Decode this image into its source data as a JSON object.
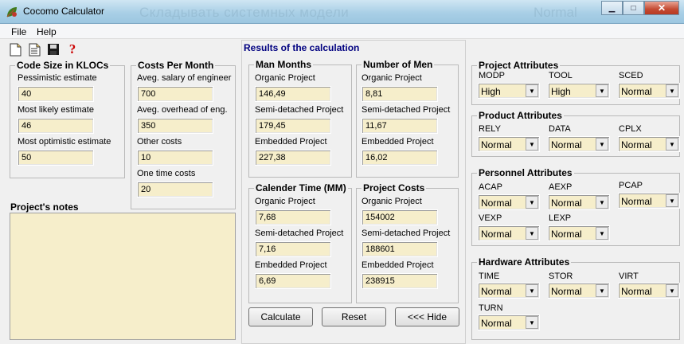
{
  "window": {
    "title": "Cocomo Calculator",
    "background_title": "Складывать системных модели",
    "background_title2": "Normal",
    "minimize_label": "▁",
    "maximize_label": "□",
    "close_label": "✕"
  },
  "menu": {
    "file": "File",
    "help": "Help"
  },
  "toolbar": {
    "help_glyph": "?"
  },
  "code_size": {
    "title": "Code Size in KLOCs",
    "pessimistic_label": "Pessimistic estimate",
    "pessimistic_value": "40",
    "likely_label": "Most likely estimate",
    "likely_value": "46",
    "optimistic_label": "Most optimistic estimate",
    "optimistic_value": "50"
  },
  "costs": {
    "title": "Costs Per Month",
    "salary_label": "Aveg. salary of engineer",
    "salary_value": "700",
    "overhead_label": "Aveg. overhead of eng.",
    "overhead_value": "350",
    "other_label": "Other costs",
    "other_value": "10",
    "onetime_label": "One time costs",
    "onetime_value": "20"
  },
  "notes": {
    "title": "Project's notes",
    "value": ""
  },
  "results": {
    "title": "Results of the calculation",
    "man_months": {
      "title": "Man Months",
      "organic_label": "Organic Project",
      "organic_value": "146,49",
      "semi_label": "Semi-detached Project",
      "semi_value": "179,45",
      "embedded_label": "Embedded Project",
      "embedded_value": "227,38"
    },
    "number_of_men": {
      "title": "Number of Men",
      "organic_label": "Organic Project",
      "organic_value": "8,81",
      "semi_label": "Semi-detached Project",
      "semi_value": "11,67",
      "embedded_label": "Embedded Project",
      "embedded_value": "16,02"
    },
    "calendar_time": {
      "title": "Calender Time (MM)",
      "organic_label": "Organic Project",
      "organic_value": "7,68",
      "semi_label": "Semi-detached Project",
      "semi_value": "7,16",
      "embedded_label": "Embedded Project",
      "embedded_value": "6,69"
    },
    "project_costs": {
      "title": "Project Costs",
      "organic_label": "Organic Project",
      "organic_value": "154002",
      "semi_label": "Semi-detached Project",
      "semi_value": "188601",
      "embedded_label": "Embedded Project",
      "embedded_value": "238915"
    },
    "buttons": {
      "calculate": "Calculate",
      "reset": "Reset",
      "hide": "<<< Hide"
    }
  },
  "project_attributes": {
    "title": "Project Attributes",
    "modp_label": "MODP",
    "modp_value": "High",
    "tool_label": "TOOL",
    "tool_value": "High",
    "sced_label": "SCED",
    "sced_value": "Normal"
  },
  "product_attributes": {
    "title": "Product Attributes",
    "rely_label": "RELY",
    "rely_value": "Normal",
    "data_label": "DATA",
    "data_value": "Normal",
    "cplx_label": "CPLX",
    "cplx_value": "Normal"
  },
  "personnel_attributes": {
    "title": "Personnel Attributes",
    "acap_label": "ACAP",
    "acap_value": "Normal",
    "aexp_label": "AEXP",
    "aexp_value": "Normal",
    "pcap_label": "PCAP",
    "pcap_value": "Normal",
    "vexp_label": "VEXP",
    "vexp_value": "Normal",
    "lexp_label": "LEXP",
    "lexp_value": "Normal"
  },
  "hardware_attributes": {
    "title": "Hardware Attributes",
    "time_label": "TIME",
    "time_value": "Normal",
    "stor_label": "STOR",
    "stor_value": "Normal",
    "virt_label": "VIRT",
    "virt_value": "Normal",
    "turn_label": "TURN",
    "turn_value": "Normal"
  },
  "colors": {
    "field_bg": "#f6eecb",
    "results_title": "#000080",
    "help_icon": "#cc0000"
  }
}
